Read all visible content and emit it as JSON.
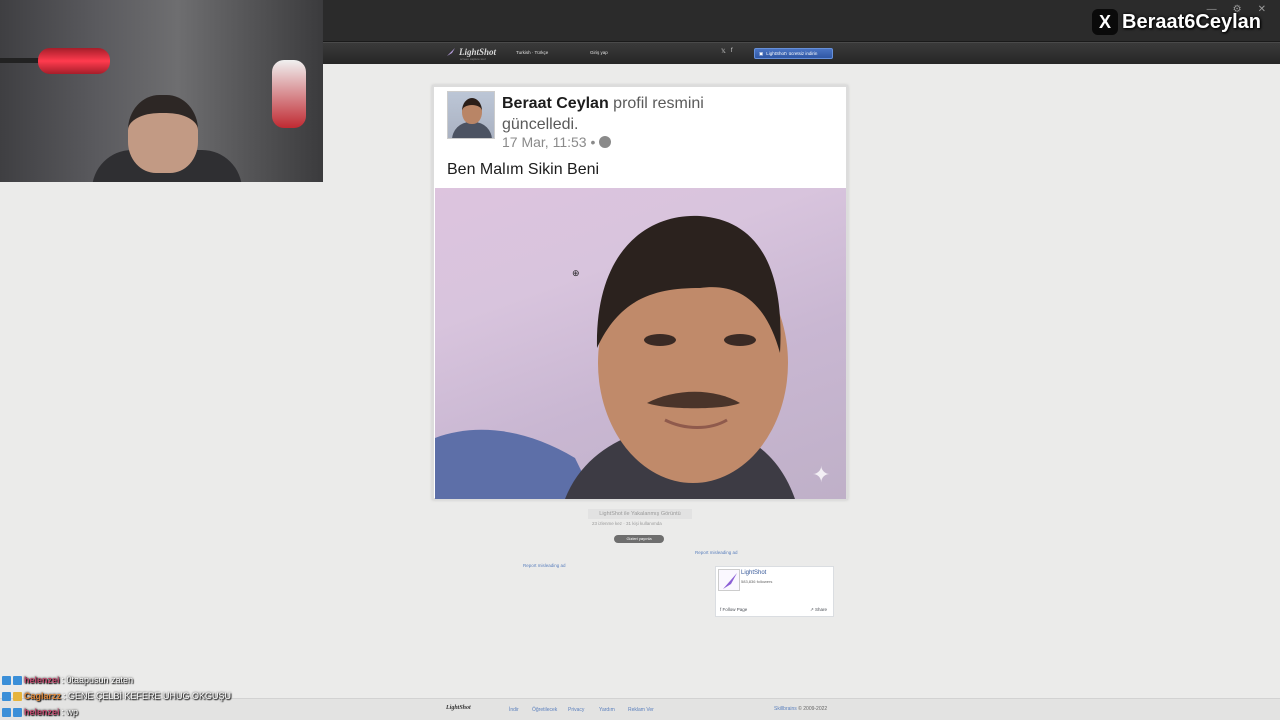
{
  "site": {
    "logo": "LightShot",
    "logo_sub": "screen capture tool",
    "lang": "Turkish · Türkçe",
    "login": "Giriş yap",
    "social_twitter": "𝕏",
    "social_facebook": "f",
    "download_btn": "LightShot'ı ücretsiz indirin"
  },
  "post": {
    "name": "Beraat Ceylan",
    "action": " profil resmini güncelledi.",
    "date": "17 Mar, 11:53 •",
    "text": "Ben Malım Sikin Beni"
  },
  "under": {
    "caption": "LightShot ile Yakalanmış Görüntü",
    "views": "23 izlenme kez · 31 kişi kullanımda",
    "hide_btn": "Gizleri yayınla",
    "report1": "Report misleading ad",
    "report2": "Report misleading ad"
  },
  "widget": {
    "name": "LightShot",
    "followers": "583,836 followers",
    "follow": "Follow Page",
    "share": "Share"
  },
  "footer": {
    "logo": "LightShot",
    "links": [
      "İndir",
      "Öğretilecek",
      "Privacy",
      "Yardım",
      "Reklam Ver"
    ],
    "brand": "Skillbrains",
    "copyright": " © 2009-2022"
  },
  "overlay": {
    "x_badge": "X",
    "streamer": "Beraat6Ceylan"
  },
  "chat": [
    {
      "user": "helenzei",
      "user_color": "#c24a6f",
      "msg": ": 0taapusun zaten",
      "badges": [
        "b1",
        "b1"
      ]
    },
    {
      "user": "Caglarzz",
      "user_color": "#e08a3c",
      "msg": ": GENE ÇELBİ KEFERE UHUG OKGUŞU",
      "badges": [
        "b1",
        "b2"
      ]
    },
    {
      "user": "helenzei",
      "user_color": "#c24a6f",
      "msg": ": wp",
      "badges": [
        "b1",
        "b1"
      ]
    }
  ]
}
